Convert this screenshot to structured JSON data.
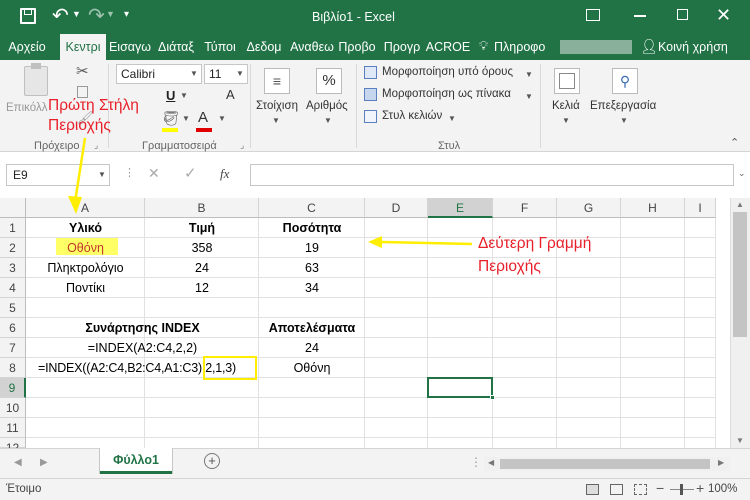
{
  "window": {
    "title": "Βιβλίο1 - Excel"
  },
  "tabs": [
    "Αρχείο",
    "Κεντρι",
    "Εισαγω",
    "Διάταξ",
    "Τύποι",
    "Δεδομ",
    "Αναθεω",
    "Προβο",
    "Προγρ",
    "ACROE"
  ],
  "tell_me": "Πληροφο",
  "share": "Κοινή χρήση",
  "ribbon": {
    "paste": "Επικόλλ",
    "font_name": "Calibri",
    "font_size": "11",
    "alignment": "Στοίχιση",
    "number": "Αριθμός",
    "conditional": "Μορφοποίηση υπό όρους",
    "format_table": "Μορφοποίηση ως πίνακα",
    "cell_styles": "Στυλ κελιών",
    "cells": "Κελιά",
    "editing": "Επεξεργασία",
    "group_clipboard": "Πρόχειρο",
    "group_font": "Γραμματοσειρά",
    "group_styles": "Στυλ"
  },
  "formula_bar": {
    "name_box": "E9",
    "fx": "fx",
    "value": ""
  },
  "columns": [
    "A",
    "B",
    "C",
    "D",
    "E",
    "F",
    "G",
    "H",
    "I"
  ],
  "rows": [
    "1",
    "2",
    "3",
    "4",
    "5",
    "6",
    "7",
    "8",
    "9",
    "10",
    "11",
    "12"
  ],
  "cells": {
    "A1": "Υλικό",
    "B1": "Τιμή",
    "C1": "Ποσότητα",
    "A2": "Οθόνη",
    "B2": "358",
    "C2": "19",
    "A3": "Πληκτρολόγιο",
    "B3": "24",
    "C3": "63",
    "A4": "Ποντίκι",
    "B4": "12",
    "C4": "34",
    "A6": "Συνάρτησης INDEX",
    "C6": "Αποτελέσματα",
    "A7": "=INDEX(A2:C4,2,2)",
    "C7": "24",
    "A8": "=INDEX((A2:C4,B2:C4,A1:C3),2,1,3)",
    "C8": "Οθόνη"
  },
  "annotations": {
    "first_column": "Πρώτη Στήλη Περιοχής",
    "first_column_l1": "Πρώτη Στήλη",
    "first_column_l2": "Περιοχής",
    "second_row_l1": "Δεύτερη Γραμμή",
    "second_row_l2": "Περιοχής"
  },
  "sheet_tab": "Φύλλο1",
  "status": {
    "ready": "Έτοιμο",
    "zoom": "100%"
  },
  "colors": {
    "brand": "#217346",
    "annotation": "#e8202a",
    "highlight": "#ffff00"
  }
}
